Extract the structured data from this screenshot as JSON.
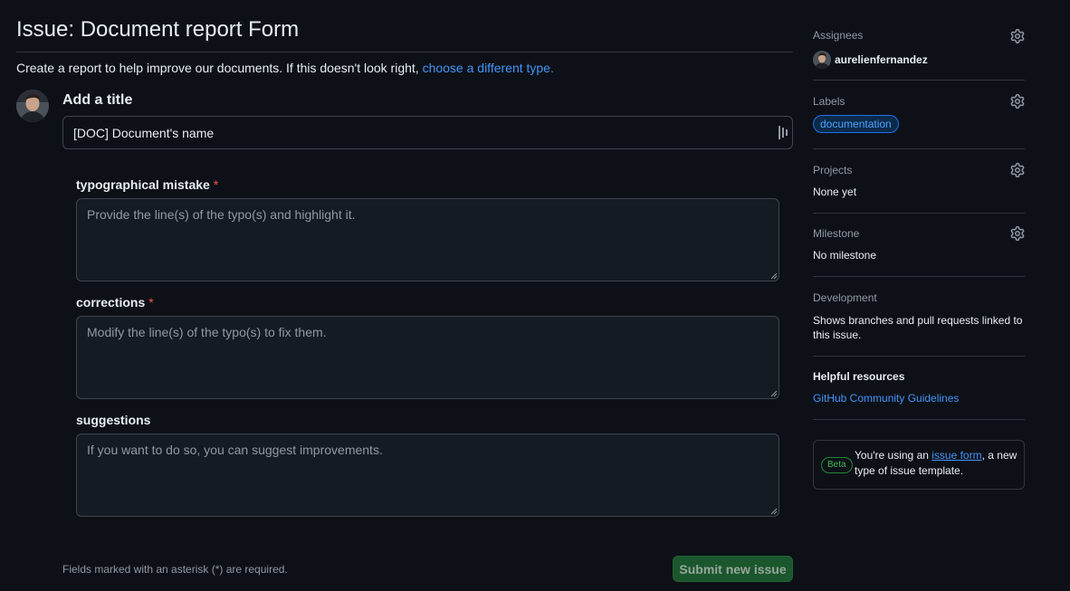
{
  "page": {
    "title": "Issue: Document report Form",
    "subtitle_text": "Create a report to help improve our documents. If this doesn't look right, ",
    "subtitle_link": "choose a different type."
  },
  "form": {
    "title_label": "Add a title",
    "title_value": "[DOC] Document's name",
    "fields": [
      {
        "label": "typographical mistake",
        "required": "*",
        "placeholder": "Provide the line(s) of the typo(s) and highlight it."
      },
      {
        "label": "corrections",
        "required": "*",
        "placeholder": "Modify the line(s) of the typo(s) to fix them."
      },
      {
        "label": "suggestions",
        "required": "",
        "placeholder": "If you want to do so, you can suggest improvements."
      }
    ],
    "footnote": "Fields marked with an asterisk (*) are required.",
    "submit_label": "Submit new issue"
  },
  "sidebar": {
    "assignees": {
      "heading": "Assignees",
      "name": "aurelienfernandez"
    },
    "labels": {
      "heading": "Labels",
      "chip": "documentation"
    },
    "projects": {
      "heading": "Projects",
      "value": "None yet"
    },
    "milestone": {
      "heading": "Milestone",
      "value": "No milestone"
    },
    "development": {
      "heading": "Development",
      "value": "Shows branches and pull requests linked to this issue."
    },
    "resources": {
      "heading": "Helpful resources",
      "link": "GitHub Community Guidelines"
    },
    "beta": {
      "badge": "Beta",
      "text_before": "You're using an ",
      "link": "issue form",
      "text_after": ", a new type of issue template."
    }
  },
  "colors": {
    "background": "#0d1117",
    "link": "#4493f8",
    "required": "#f85149",
    "submit": "#1f6f34",
    "label_chip": "#4da2ff"
  },
  "icons": [
    "gear-icon",
    "avatar",
    "text-expander-icon",
    "resize-grip-icon"
  ]
}
